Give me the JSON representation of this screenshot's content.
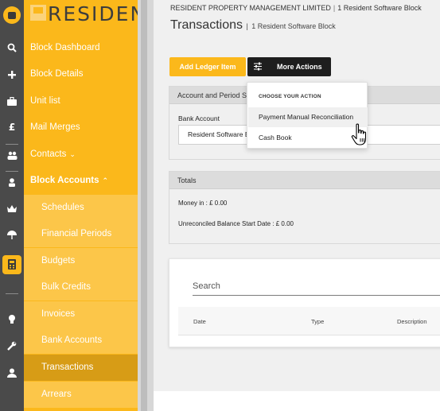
{
  "app": {
    "brand": "RESIDENT"
  },
  "sidebar": {
    "items": [
      {
        "label": "Block Dashboard"
      },
      {
        "label": "Block Details"
      },
      {
        "label": "Unit list"
      },
      {
        "label": "Mail Merges"
      },
      {
        "label": "Contacts",
        "caret": "⌄"
      },
      {
        "label": "Block Accounts",
        "caret": "⌃"
      },
      {
        "label": "Schedules"
      },
      {
        "label": "Financial Periods"
      },
      {
        "label": "Budgets"
      },
      {
        "label": "Bulk Credits"
      },
      {
        "label": "Invoices"
      },
      {
        "label": "Bank Accounts"
      },
      {
        "label": "Transactions"
      },
      {
        "label": "Arrears"
      }
    ]
  },
  "rail_icons": [
    "logo-icon",
    "search-icon",
    "plus-icon",
    "briefcase-icon",
    "pound-icon",
    "people-icon",
    "person-badge-icon",
    "crown-icon",
    "umbrella-icon",
    "calculator-icon",
    "bulb-icon",
    "wrench-icon",
    "user-icon"
  ],
  "header": {
    "company": "RESIDENT PROPERTY MANAGEMENT LIMITED",
    "block_crumb": "1 Resident Software Block",
    "title": "Transactions",
    "title_block": "1 Resident Software Block"
  },
  "toolbar": {
    "add_ledger": "Add Ledger Item",
    "more_actions": "More Actions"
  },
  "dropdown": {
    "heading": "CHOOSE YOUR ACTION",
    "items": [
      "Payment Manual Reconciliation",
      "Cash Book"
    ]
  },
  "account_panel": {
    "heading": "Account and Period S",
    "bank_label": "Bank Account",
    "bank_value": "Resident Software B"
  },
  "totals_panel": {
    "heading": "Totals",
    "money_in": "Money in : £ 0.00",
    "unreconciled": "Unreconciled Balance Start Date : £ 0.00"
  },
  "table": {
    "search_placeholder": "Search",
    "columns": [
      "Date",
      "Type",
      "Description"
    ]
  },
  "colors": {
    "accent": "#fbb81b",
    "sidebar_active": "#d79c16",
    "rail": "#4a4a4a",
    "dark_button": "#1e1e1e"
  }
}
